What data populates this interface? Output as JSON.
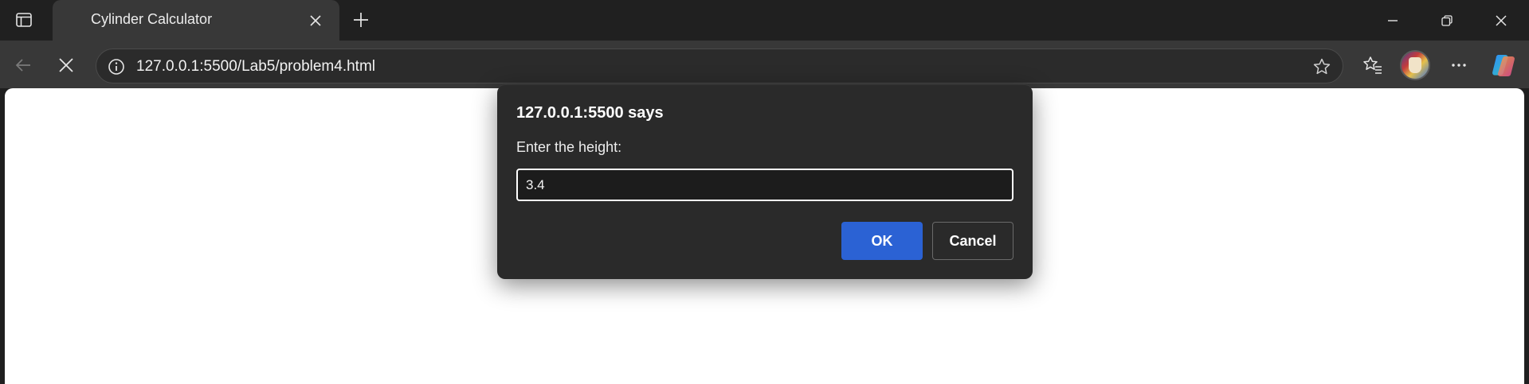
{
  "browser": {
    "tab": {
      "title": "Cylinder Calculator"
    },
    "address_bar": {
      "url": "127.0.0.1:5500/Lab5/problem4.html"
    },
    "icons": {
      "tab_actions": "tab-actions-icon",
      "tab_close": "close-icon",
      "new_tab": "plus-icon",
      "minimize": "minimize-icon",
      "restore": "restore-icon",
      "close_window": "close-icon",
      "back": "back-arrow-icon",
      "stop": "stop-icon",
      "site_info": "info-icon",
      "favorite": "star-icon",
      "favorites": "favorites-icon",
      "profile": "avatar",
      "more": "more-icon",
      "copilot": "copilot-icon"
    }
  },
  "dialog": {
    "title": "127.0.0.1:5500 says",
    "message": "Enter the height:",
    "input_value": "3.4",
    "ok_label": "OK",
    "cancel_label": "Cancel"
  },
  "colors": {
    "tabstrip": "#202020",
    "toolbar": "#383838",
    "dialog_bg": "#2a2a2a",
    "accent": "#2b62d4",
    "page_bg": "#ffffff"
  }
}
